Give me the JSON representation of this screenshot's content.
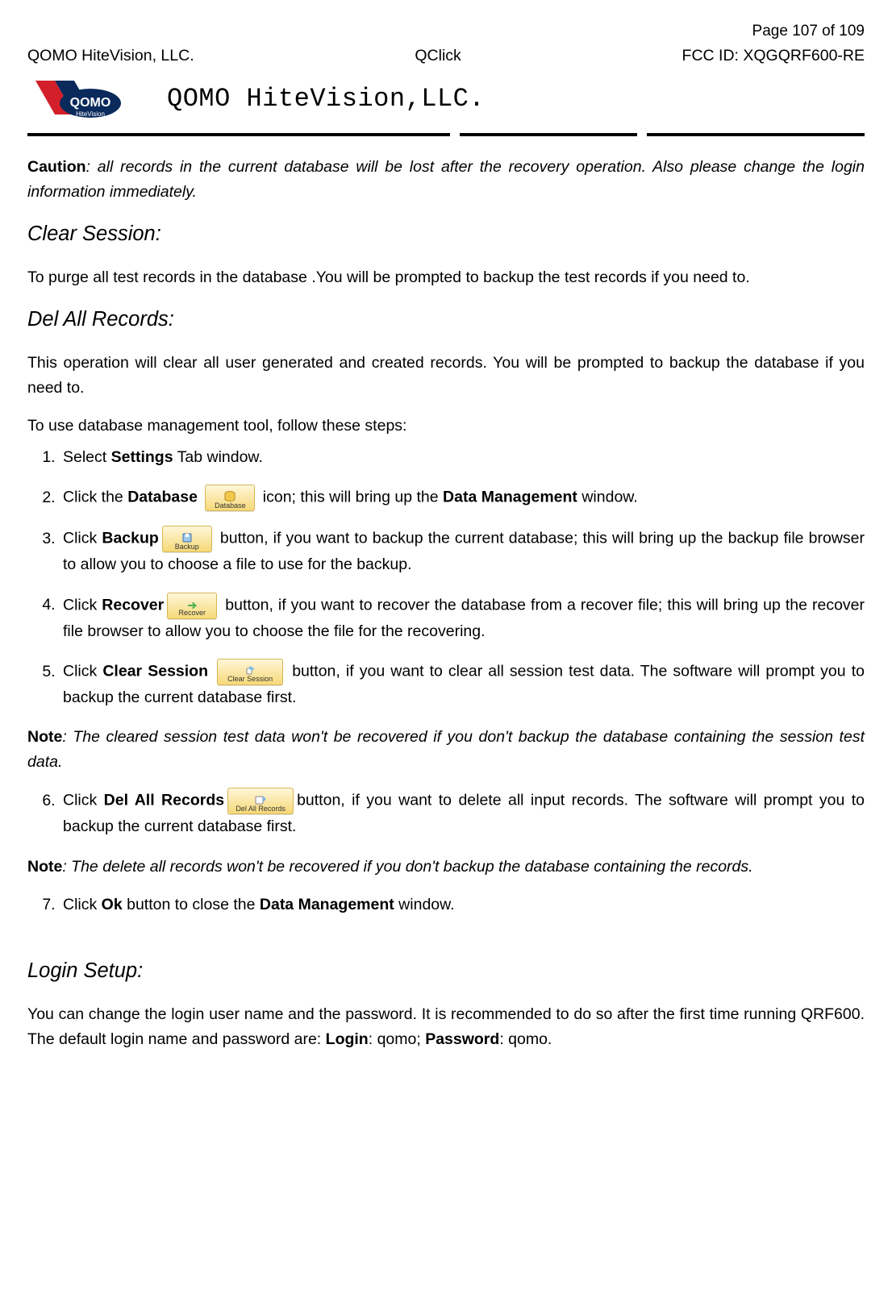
{
  "header": {
    "page_label_prefix": "Page ",
    "page_current": "107",
    "page_of": " of ",
    "page_total": "109",
    "company": "QOMO HiteVision, LLC.",
    "product": "QClick",
    "fcc_prefix": "FCC ID: ",
    "fcc_id": "XQGQRF600-RE",
    "brand_text": "QOMO HiteVision,LLC."
  },
  "caution": {
    "label": "Caution",
    "text": ": all records in the current database will be lost after the recovery operation. Also please change the login information immediately."
  },
  "sections": {
    "clear_session": {
      "title": "Clear Session:",
      "body": "To purge all test records in the database .You will be prompted to backup the test records if you need to."
    },
    "del_all": {
      "title": "Del All Records:",
      "intro": "This operation will clear all user generated and created records. You will be prompted to backup the database if you need to.",
      "lead": "To use database management tool, follow these steps:"
    },
    "login": {
      "title": "Login Setup:",
      "body_a": "You can change the login user name and the password. It is recommended to do so after the first time running QRF600. The default login name and password are: ",
      "login_label": "Login",
      "login_sep": ": qomo; ",
      "password_label": "Password",
      "password_val": ": qomo."
    }
  },
  "steps": {
    "s1_a": "Select ",
    "s1_b": "Settings",
    "s1_c": " Tab window.",
    "s2_a": "Click the ",
    "s2_b": "Database",
    "s2_c": " icon; this will bring up the ",
    "s2_d": "Data Management",
    "s2_e": " window.",
    "s3_a": "Click ",
    "s3_b": "Backup",
    "s3_c": " button, if you want to backup the current database; this will bring up the backup file browser to allow you to choose a file to use for the backup.",
    "s4_a": "Click ",
    "s4_b": "Recover",
    "s4_c": " button, if you want to recover the database from a recover file; this will bring up the recover file browser to allow you to choose the file for the recovering.",
    "s5_a": "Click ",
    "s5_b": "Clear Session",
    "s5_c": " button, if you want to clear all session test data. The software will prompt you to backup the current database first.",
    "s6_a": "Click ",
    "s6_b": "Del All Records",
    "s6_c": "button, if you want to delete all input records. The software will prompt you to backup the current database first.",
    "s7_a": "Click ",
    "s7_b": "Ok",
    "s7_c": " button to close the ",
    "s7_d": "Data Management",
    "s7_e": " window."
  },
  "notes": {
    "n1_label": "Note",
    "n1_text": ": The cleared session test data won't be recovered if you don't backup the database containing the session test data.",
    "n2_label": "Note",
    "n2_text": ": The delete all records won't be recovered if you don't backup the database containing the records."
  },
  "icons": {
    "database": "Database",
    "backup": "Backup",
    "recover": "Recover",
    "clear_session": "Clear Session",
    "del_all": "Del All Records"
  }
}
